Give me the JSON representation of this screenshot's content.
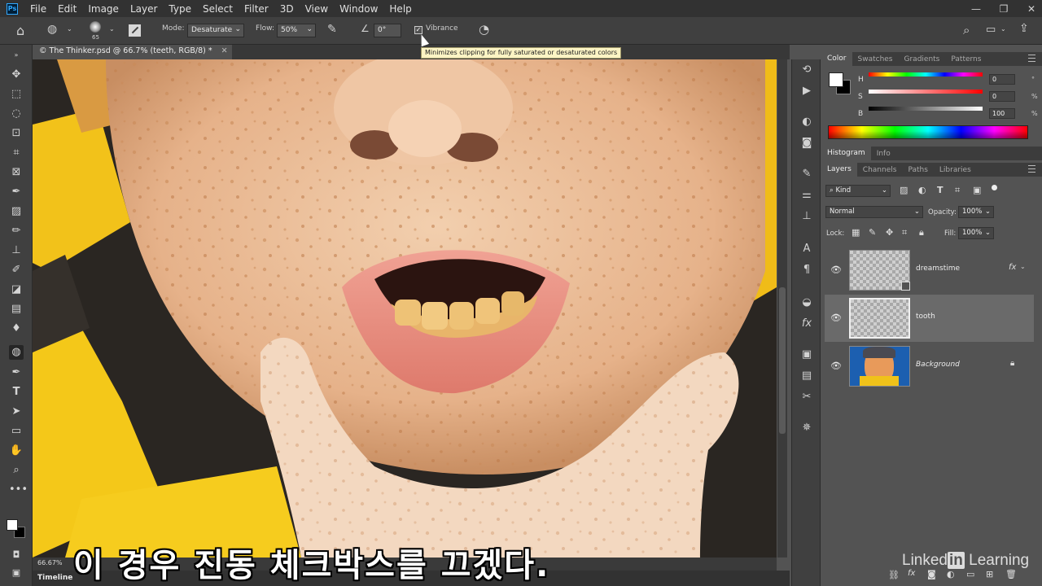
{
  "menu": [
    "File",
    "Edit",
    "Image",
    "Layer",
    "Type",
    "Select",
    "Filter",
    "3D",
    "View",
    "Window",
    "Help"
  ],
  "app_logo": "Ps",
  "options": {
    "brush_size": "65",
    "mode_label": "Mode:",
    "mode_value": "Desaturate",
    "flow_label": "Flow:",
    "flow_value": "50%",
    "angle_value": "0°",
    "vibrance_label": "Vibrance",
    "vibrance_checked": true
  },
  "tooltip": "Minimizes clipping for fully saturated or desaturated colors",
  "document_tab": "© The Thinker.psd @ 66.7% (teeth, RGB/8) *",
  "status": {
    "zoom": "66.67%",
    "timeline": "Timeline"
  },
  "color_panel": {
    "tabs": [
      "Color",
      "Swatches",
      "Gradients",
      "Patterns"
    ],
    "h_label": "H",
    "h_value": "0",
    "h_unit": "°",
    "s_label": "S",
    "s_value": "0",
    "s_unit": "%",
    "b_label": "B",
    "b_value": "100",
    "b_unit": "%"
  },
  "histogram_tabs": [
    "Histogram",
    "Info"
  ],
  "layers_panel": {
    "tabs": [
      "Layers",
      "Channels",
      "Paths",
      "Libraries"
    ],
    "filter_kind": "Kind",
    "blend_mode": "Normal",
    "opacity_label": "Opacity:",
    "opacity_value": "100%",
    "lock_label": "Lock:",
    "fill_label": "Fill:",
    "fill_value": "100%",
    "layers": [
      {
        "name": "dreamstime",
        "fx": "fx"
      },
      {
        "name": "tooth"
      },
      {
        "name": "Background"
      }
    ]
  },
  "subtitle": "이 경우 진동 체크박스를 끄겠다.",
  "watermark": {
    "prefix": "Linked",
    "badge": "in",
    "suffix": " Learning"
  },
  "icons": {
    "home": "home-icon",
    "brush": "sponge-brush-icon",
    "airbrush": "airbrush-icon",
    "search": "search-icon",
    "share": "share-icon",
    "workspace": "workspace-icon"
  }
}
